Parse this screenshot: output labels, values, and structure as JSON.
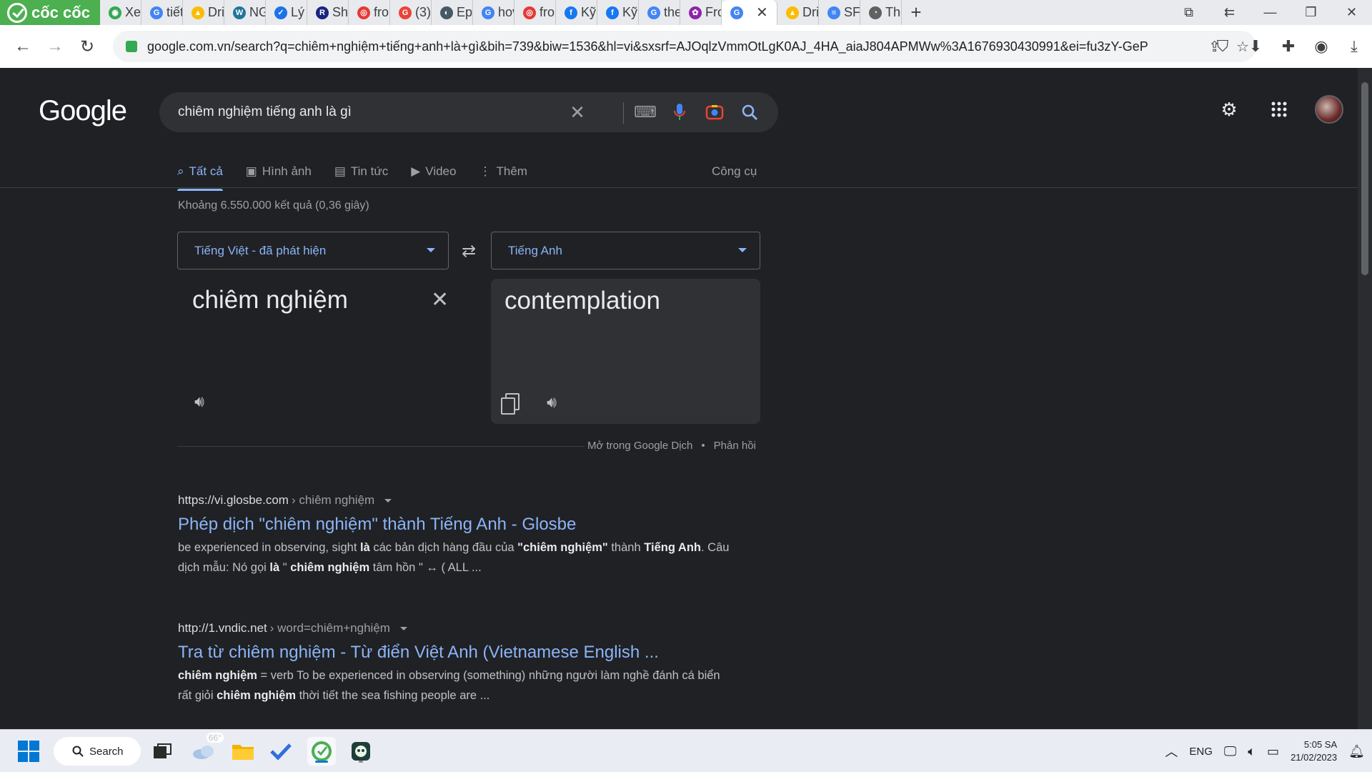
{
  "browser": {
    "brand": "cốc cốc",
    "tabs": [
      {
        "label": "Xen",
        "color": "#34a853",
        "glyph": "◉"
      },
      {
        "label": "tiết",
        "color": "#4285f4",
        "glyph": "G"
      },
      {
        "label": "Driv",
        "color": "#fbbc04",
        "glyph": "▲"
      },
      {
        "label": "NG",
        "color": "#21759b",
        "glyph": "W"
      },
      {
        "label": "Lý t",
        "color": "#1a73e8",
        "glyph": "✓"
      },
      {
        "label": "Shi",
        "color": "#1a237e",
        "glyph": "R"
      },
      {
        "label": "fro",
        "color": "#e53935",
        "glyph": "◎"
      },
      {
        "label": "(3)",
        "color": "#ea4335",
        "glyph": "G"
      },
      {
        "label": "Epi",
        "color": "#455a64",
        "glyph": "◐"
      },
      {
        "label": "hov",
        "color": "#4285f4",
        "glyph": "G"
      },
      {
        "label": "fro",
        "color": "#e53935",
        "glyph": "◎"
      },
      {
        "label": "Kỹ",
        "color": "#1877f2",
        "glyph": "f"
      },
      {
        "label": "Kỹ",
        "color": "#1877f2",
        "glyph": "f"
      },
      {
        "label": "the",
        "color": "#4285f4",
        "glyph": "G"
      },
      {
        "label": "Fro",
        "color": "#8e24aa",
        "glyph": "✿"
      }
    ],
    "active_tab": {
      "label": "",
      "color": "#4285f4",
      "glyph": "G"
    },
    "tabs_after": [
      {
        "label": "Driv",
        "color": "#fbbc04",
        "glyph": "▲"
      },
      {
        "label": "SFU",
        "color": "#4285f4",
        "glyph": "≡"
      },
      {
        "label": "Thé",
        "color": "#616161",
        "glyph": "◔"
      }
    ],
    "url": "google.com.vn/search?q=chiêm+nghiệm+tiếng+anh+là+gì&bih=739&biw=1536&hl=vi&sxsrf=AJOqlzVmmOtLgK0AJ_4HA_aiaJ804APMWw%3A1676930430991&ei=fu3zY-GeP..."
  },
  "google": {
    "logo": "Google",
    "query": "chiêm nghiệm tiếng anh là gì",
    "tabs": [
      {
        "label": "Tất cả",
        "icon": "⌕",
        "active": true
      },
      {
        "label": "Hình ảnh",
        "icon": "▣",
        "active": false
      },
      {
        "label": "Tin tức",
        "icon": "▤",
        "active": false
      },
      {
        "label": "Video",
        "icon": "▶",
        "active": false
      },
      {
        "label": "Thêm",
        "icon": "⋮",
        "active": false
      }
    ],
    "tools": "Công cụ",
    "stats": "Khoảng 6.550.000 kết quả (0,36 giây)"
  },
  "translate": {
    "source_lang": "Tiếng Việt - đã phát hiện",
    "target_lang": "Tiếng Anh",
    "source_text": "chiêm nghiệm",
    "target_text": "contemplation",
    "open_in": "Mở trong Google Dịch",
    "bullet": "•",
    "feedback": "Phản hồi"
  },
  "results": [
    {
      "site": "https://vi.glosbe.com",
      "path": "› chiêm nghiệm",
      "title": "Phép dịch \"chiêm nghiệm\" thành Tiếng Anh - Glosbe",
      "snippet_html": "be experienced in observing, sight <b>là</b> các bản dịch hàng đầu của <b>\"chiêm nghiệm\"</b> thành <b>Tiếng Anh</b>. Câu dịch mẫu: Nó gọi <b>là</b> \" <b>chiêm nghiệm</b> tâm hồn \" ↔ ( ALL ..."
    },
    {
      "site": "http://1.vndic.net",
      "path": "› word=chiêm+nghiệm",
      "title": "Tra từ chiêm nghiệm - Từ điển Việt Anh (Vietnamese English ...",
      "snippet_html": "<b>chiêm nghiệm</b> = verb To be experienced in observing (something) những người làm nghề đánh cá biển rất giỏi <b>chiêm nghiệm</b> thời tiết the sea fishing people are ..."
    }
  ],
  "taskbar": {
    "search_label": "Search",
    "weather": "66°",
    "lang": "ENG",
    "time": "5:05 SA",
    "date": "21/02/2023"
  }
}
